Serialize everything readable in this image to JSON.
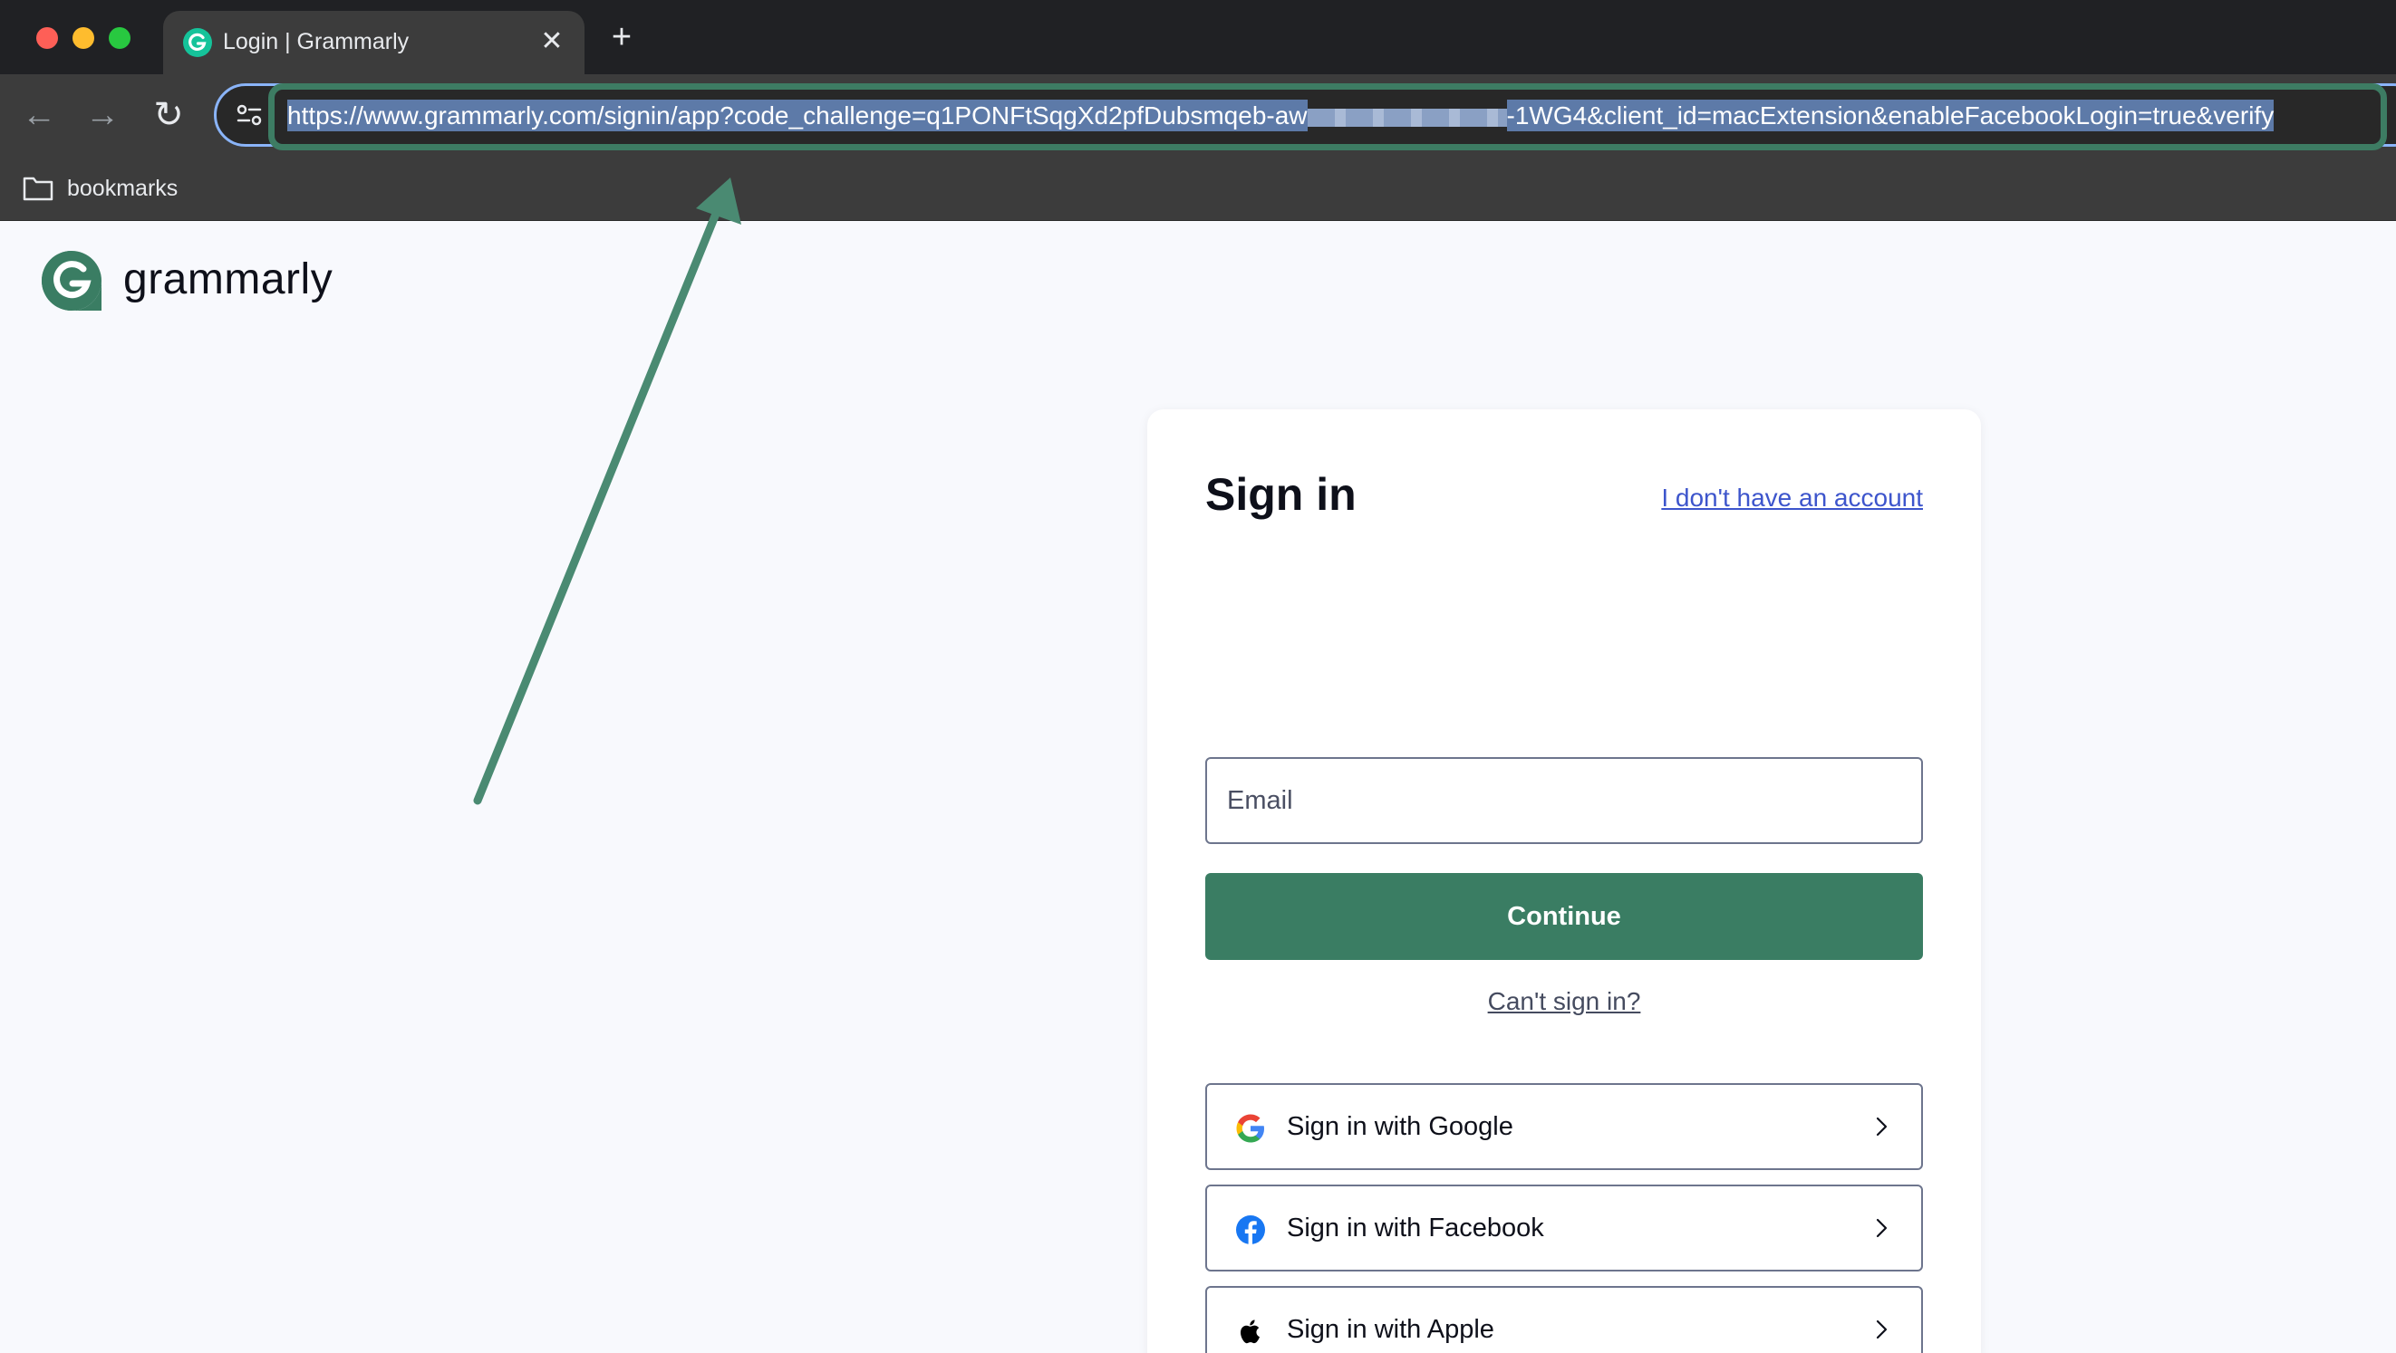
{
  "browser": {
    "tab": {
      "title": "Login | Grammarly",
      "close_glyph": "✕",
      "favicon": "grammarly-g-icon"
    },
    "new_tab_glyph": "+",
    "nav": {
      "back_glyph": "←",
      "forward_glyph": "→",
      "reload_glyph": "↻"
    },
    "url": {
      "part1": "https://www.grammarly.com/signin/app?code_challenge=q1PONFtSqgXd2pfDubsmqeb-aw",
      "part2": "-1WG4&client_id=macExtension&enableFacebookLogin=true&verify"
    },
    "bookmarks": {
      "folder_label": "bookmarks"
    }
  },
  "page": {
    "logo_text": "grammarly",
    "signin": {
      "title": "Sign in",
      "no_account_link": "I don't have an account",
      "email_placeholder": "Email",
      "continue_label": "Continue",
      "cant_sign_in": "Can't sign in?",
      "google_label": "Sign in with Google",
      "facebook_label": "Sign in with Facebook",
      "apple_label": "Sign in with Apple"
    }
  },
  "colors": {
    "brand_green": "#3a7d63",
    "annotation_green": "#3d7c63",
    "link_blue": "#3d55cc"
  }
}
